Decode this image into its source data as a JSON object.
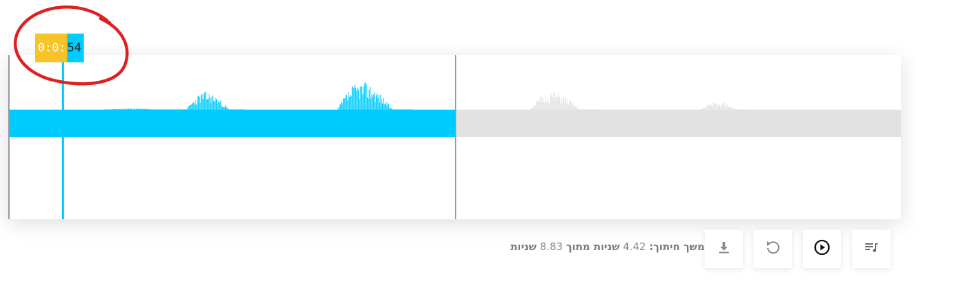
{
  "playhead": {
    "time_highlight": "0:0:",
    "time_rest": "54"
  },
  "waveform": {
    "active_color": "#00cbff",
    "inactive_color": "#e2e2e2",
    "playhead_color": "#00cbff",
    "split_marker_color": "#9a9a9a"
  },
  "annotation": {
    "color": "#e02020",
    "shape": "hand-drawn circle around time label"
  },
  "toolbar": {
    "buttons": [
      {
        "name": "playlist-icon"
      },
      {
        "name": "play-icon"
      },
      {
        "name": "undo-icon"
      },
      {
        "name": "download-icon"
      }
    ]
  },
  "status": {
    "label_prefix": "משך חיתוך:",
    "cut_duration": "4.42",
    "middle_text": "שניות מתוך",
    "total_duration": "8.83",
    "suffix": "שניות"
  }
}
